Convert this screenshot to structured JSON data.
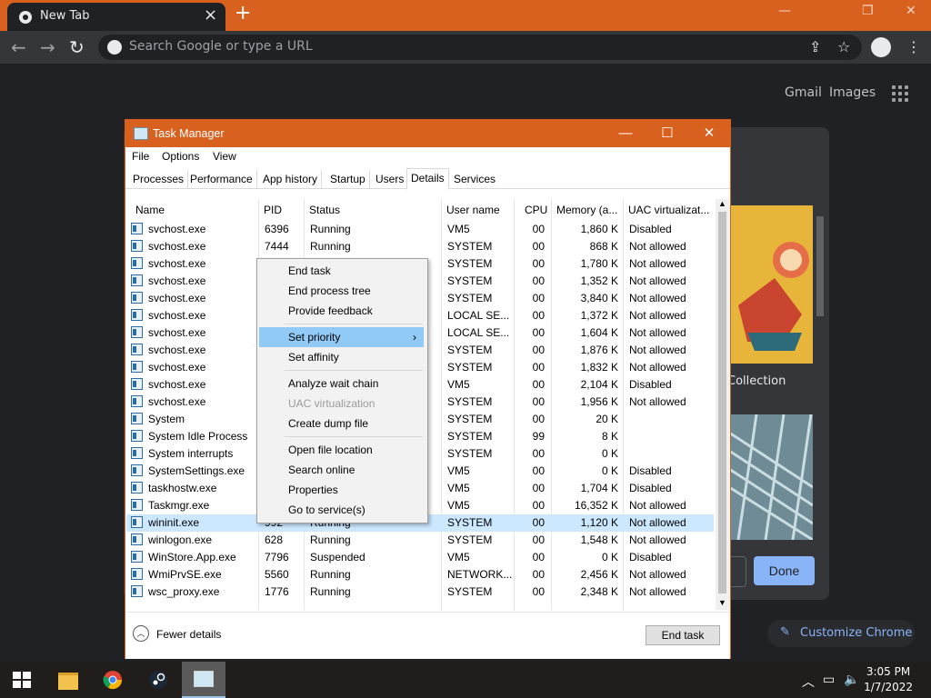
{
  "chrome": {
    "tab_title": "New Tab",
    "omnibox_placeholder": "Search Google or type a URL",
    "gmail": "Gmail",
    "images": "Images",
    "collection_label": "Collection",
    "done": "Done",
    "customize": "Customize Chrome"
  },
  "taskmanager": {
    "title": "Task Manager",
    "menu": [
      "File",
      "Options",
      "View"
    ],
    "tabs": [
      "Processes",
      "Performance",
      "App history",
      "Startup",
      "Users",
      "Details",
      "Services"
    ],
    "active_tab": "Details",
    "columns": [
      "Name",
      "PID",
      "Status",
      "User name",
      "CPU",
      "Memory (a...",
      "UAC virtualizat..."
    ],
    "rows": [
      {
        "name": "svchost.exe",
        "pid": "6396",
        "status": "Running",
        "user": "VM5",
        "cpu": "00",
        "mem": "1,860 K",
        "uac": "Disabled"
      },
      {
        "name": "svchost.exe",
        "pid": "7444",
        "status": "Running",
        "user": "SYSTEM",
        "cpu": "00",
        "mem": "868 K",
        "uac": "Not allowed"
      },
      {
        "name": "svchost.exe",
        "pid": "",
        "status": "",
        "user": "SYSTEM",
        "cpu": "00",
        "mem": "1,780 K",
        "uac": "Not allowed"
      },
      {
        "name": "svchost.exe",
        "pid": "",
        "status": "",
        "user": "SYSTEM",
        "cpu": "00",
        "mem": "1,352 K",
        "uac": "Not allowed"
      },
      {
        "name": "svchost.exe",
        "pid": "",
        "status": "",
        "user": "SYSTEM",
        "cpu": "00",
        "mem": "3,840 K",
        "uac": "Not allowed"
      },
      {
        "name": "svchost.exe",
        "pid": "",
        "status": "",
        "user": "LOCAL SE...",
        "cpu": "00",
        "mem": "1,372 K",
        "uac": "Not allowed"
      },
      {
        "name": "svchost.exe",
        "pid": "",
        "status": "",
        "user": "LOCAL SE...",
        "cpu": "00",
        "mem": "1,604 K",
        "uac": "Not allowed"
      },
      {
        "name": "svchost.exe",
        "pid": "",
        "status": "",
        "user": "SYSTEM",
        "cpu": "00",
        "mem": "1,876 K",
        "uac": "Not allowed"
      },
      {
        "name": "svchost.exe",
        "pid": "",
        "status": "",
        "user": "SYSTEM",
        "cpu": "00",
        "mem": "1,832 K",
        "uac": "Not allowed"
      },
      {
        "name": "svchost.exe",
        "pid": "",
        "status": "",
        "user": "VM5",
        "cpu": "00",
        "mem": "2,104 K",
        "uac": "Disabled"
      },
      {
        "name": "svchost.exe",
        "pid": "",
        "status": "",
        "user": "SYSTEM",
        "cpu": "00",
        "mem": "1,956 K",
        "uac": "Not allowed"
      },
      {
        "name": "System",
        "pid": "",
        "status": "",
        "user": "SYSTEM",
        "cpu": "00",
        "mem": "20 K",
        "uac": ""
      },
      {
        "name": "System Idle Process",
        "pid": "",
        "status": "",
        "user": "SYSTEM",
        "cpu": "99",
        "mem": "8 K",
        "uac": ""
      },
      {
        "name": "System interrupts",
        "pid": "",
        "status": "",
        "user": "SYSTEM",
        "cpu": "00",
        "mem": "0 K",
        "uac": ""
      },
      {
        "name": "SystemSettings.exe",
        "pid": "",
        "status": "",
        "user": "VM5",
        "cpu": "00",
        "mem": "0 K",
        "uac": "Disabled"
      },
      {
        "name": "taskhostw.exe",
        "pid": "",
        "status": "",
        "user": "VM5",
        "cpu": "00",
        "mem": "1,704 K",
        "uac": "Disabled"
      },
      {
        "name": "Taskmgr.exe",
        "pid": "",
        "status": "",
        "user": "VM5",
        "cpu": "00",
        "mem": "16,352 K",
        "uac": "Not allowed"
      },
      {
        "name": "wininit.exe",
        "pid": "992",
        "status": "Running",
        "user": "SYSTEM",
        "cpu": "00",
        "mem": "1,120 K",
        "uac": "Not allowed"
      },
      {
        "name": "winlogon.exe",
        "pid": "628",
        "status": "Running",
        "user": "SYSTEM",
        "cpu": "00",
        "mem": "1,548 K",
        "uac": "Not allowed"
      },
      {
        "name": "WinStore.App.exe",
        "pid": "7796",
        "status": "Suspended",
        "user": "VM5",
        "cpu": "00",
        "mem": "0 K",
        "uac": "Disabled"
      },
      {
        "name": "WmiPrvSE.exe",
        "pid": "5560",
        "status": "Running",
        "user": "NETWORK...",
        "cpu": "00",
        "mem": "2,456 K",
        "uac": "Not allowed"
      },
      {
        "name": "wsc_proxy.exe",
        "pid": "1776",
        "status": "Running",
        "user": "SYSTEM",
        "cpu": "00",
        "mem": "2,348 K",
        "uac": "Not allowed"
      }
    ],
    "selected_row": 17,
    "fewer_details": "Fewer details",
    "end_task": "End task"
  },
  "context_menu": {
    "items": [
      {
        "label": "End task"
      },
      {
        "label": "End process tree"
      },
      {
        "label": "Provide feedback"
      },
      {
        "sep": true
      },
      {
        "label": "Set priority",
        "submenu": true,
        "highlighted": true
      },
      {
        "label": "Set affinity"
      },
      {
        "sep": true
      },
      {
        "label": "Analyze wait chain"
      },
      {
        "label": "UAC virtualization",
        "disabled": true
      },
      {
        "label": "Create dump file"
      },
      {
        "sep": true
      },
      {
        "label": "Open file location"
      },
      {
        "label": "Search online"
      },
      {
        "label": "Properties"
      },
      {
        "label": "Go to service(s)"
      }
    ]
  },
  "taskbar": {
    "time": "3:05 PM",
    "date": "1/7/2022"
  },
  "colors": {
    "accent": "#d9611f",
    "selection": "#cce8ff",
    "menu_highlight": "#91c9f7"
  }
}
